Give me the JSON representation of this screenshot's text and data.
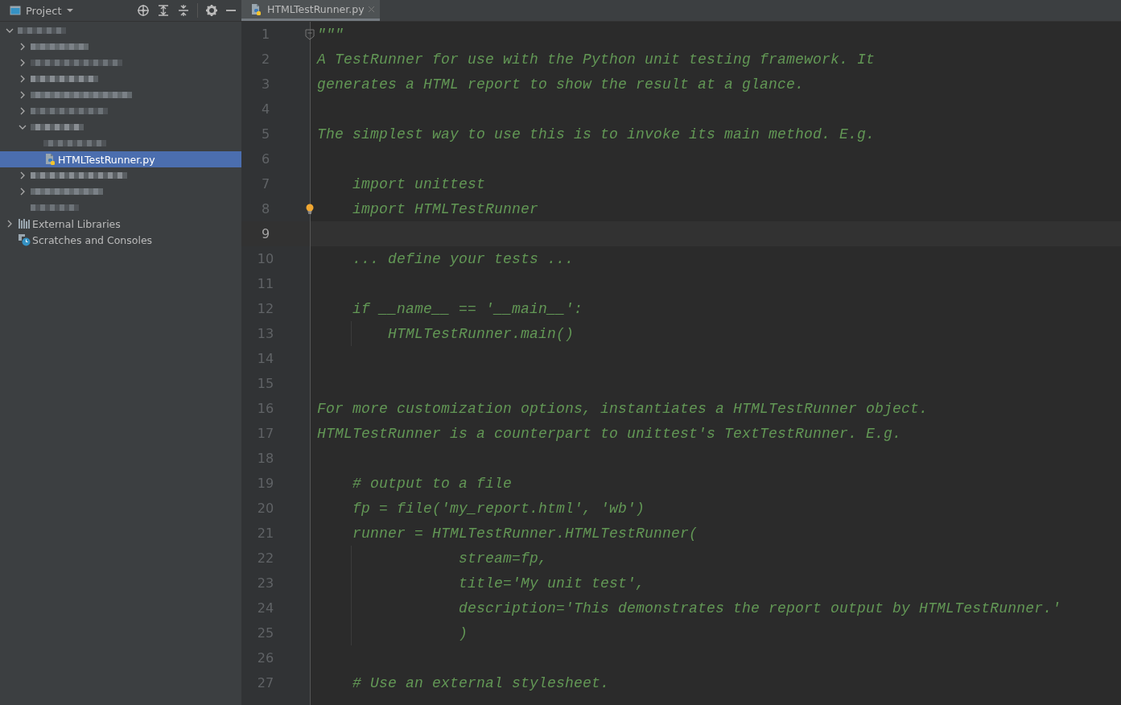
{
  "project_panel": {
    "title": "Project",
    "tree": [
      {
        "kind": "pixelated",
        "expanded": true,
        "selected": false,
        "children": [
          {
            "kind": "pixelated",
            "expanded": false,
            "selected": false
          },
          {
            "kind": "pixelated",
            "expanded": false,
            "selected": false
          },
          {
            "kind": "pixelated",
            "expanded": false,
            "selected": false
          },
          {
            "kind": "pixelated",
            "expanded": false,
            "selected": false
          },
          {
            "kind": "pixelated",
            "expanded": false,
            "selected": false
          },
          {
            "kind": "pixelated",
            "expanded": true,
            "selected": false,
            "children": [
              {
                "kind": "pixelated",
                "selected": false
              },
              {
                "kind": "python_file",
                "label": "HTMLTestRunner.py",
                "selected": true
              }
            ]
          },
          {
            "kind": "pixelated",
            "expanded": false,
            "selected": false
          },
          {
            "kind": "pixelated",
            "expanded": false,
            "selected": false
          },
          {
            "kind": "pixelated",
            "selected": false
          }
        ]
      },
      {
        "kind": "libraries",
        "label": "External Libraries",
        "expanded": false,
        "selected": false
      },
      {
        "kind": "scratches",
        "label": "Scratches and Consoles",
        "selected": false
      }
    ]
  },
  "editor": {
    "tabs": [
      {
        "label": "HTMLTestRunner.py",
        "selected": true
      }
    ],
    "lines": [
      {
        "kind": "fold",
        "number": "1",
        "text": "\"\"\"",
        "current": false
      },
      {
        "kind": "plain",
        "number": "2",
        "text": "A TestRunner for use with the Python unit testing framework. It",
        "current": false
      },
      {
        "kind": "plain",
        "number": "3",
        "text": "generates a HTML report to show the result at a glance.",
        "current": false
      },
      {
        "kind": "plain",
        "number": "4",
        "current": false
      },
      {
        "kind": "plain",
        "number": "5",
        "text": "The simplest way to use this is to invoke its main method. E.g.",
        "current": false
      },
      {
        "kind": "plain",
        "number": "6",
        "current": false
      },
      {
        "kind": "plain",
        "number": "7",
        "text": "    import unittest",
        "current": false
      },
      {
        "kind": "bulb",
        "number": "8",
        "text": "    import HTMLTestRunner",
        "current": false
      },
      {
        "kind": "plain",
        "number": "9",
        "current": true
      },
      {
        "kind": "plain",
        "number": "10",
        "text": "    ... define your tests ...",
        "current": false
      },
      {
        "kind": "plain",
        "number": "11",
        "current": false
      },
      {
        "kind": "plain",
        "number": "12",
        "text": "    if __name__ == '__main__':",
        "current": false
      },
      {
        "kind": "plain",
        "number": "13",
        "text": "        HTMLTestRunner.main()",
        "current": false,
        "guide": true
      },
      {
        "kind": "plain",
        "number": "14",
        "current": false
      },
      {
        "kind": "plain",
        "number": "15",
        "current": false
      },
      {
        "kind": "plain",
        "number": "16",
        "text": "For more customization options, instantiates a HTMLTestRunner object.",
        "current": false
      },
      {
        "kind": "plain",
        "number": "17",
        "text": "HTMLTestRunner is a counterpart to unittest's TextTestRunner. E.g.",
        "current": false
      },
      {
        "kind": "plain",
        "number": "18",
        "current": false
      },
      {
        "kind": "plain",
        "number": "19",
        "text": "    # output to a file",
        "current": false
      },
      {
        "kind": "plain",
        "number": "20",
        "text": "    fp = file('my_report.html', 'wb')",
        "current": false
      },
      {
        "kind": "plain",
        "number": "21",
        "text": "    runner = HTMLTestRunner.HTMLTestRunner(",
        "current": false
      },
      {
        "kind": "plain",
        "number": "22",
        "text": "                stream=fp,",
        "current": false,
        "guide": true
      },
      {
        "kind": "plain",
        "number": "23",
        "text": "                title='My unit test',",
        "current": false,
        "guide": true
      },
      {
        "kind": "plain",
        "number": "24",
        "text": "                description='This demonstrates the report output by HTMLTestRunner.'",
        "current": false,
        "guide": true
      },
      {
        "kind": "plain",
        "number": "25",
        "text": "                )",
        "current": false,
        "guide": true
      },
      {
        "kind": "plain",
        "number": "26",
        "current": false
      },
      {
        "kind": "plain",
        "number": "27",
        "text": "    # Use an external stylesheet.",
        "current": false
      }
    ]
  }
}
